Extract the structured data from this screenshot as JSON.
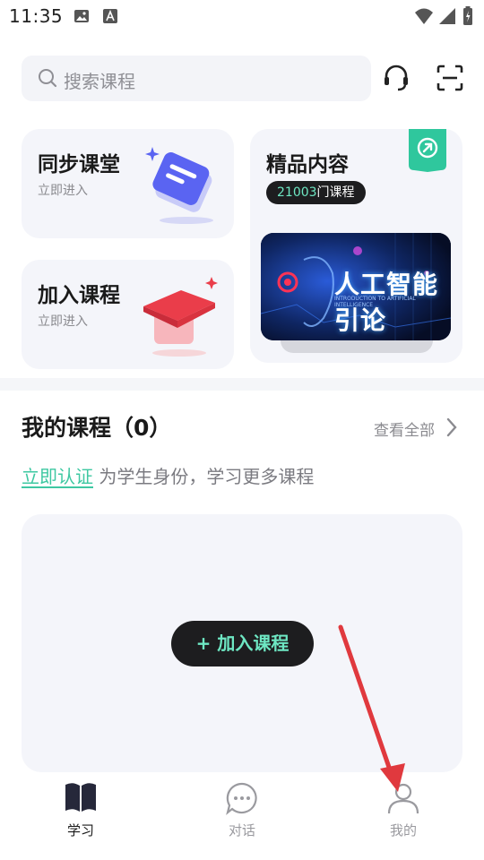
{
  "status_bar": {
    "time": "11:35",
    "icons": [
      "image-icon",
      "font-a-icon",
      "wifi-icon",
      "signal-icon",
      "battery-icon"
    ]
  },
  "search": {
    "placeholder": "搜索课程"
  },
  "header_icons": [
    "headset-icon",
    "scan-icon"
  ],
  "cards": {
    "sync_class": {
      "title": "同步课堂",
      "subtitle": "立即进入"
    },
    "join_course": {
      "title": "加入课程",
      "subtitle": "立即进入"
    },
    "premium": {
      "title": "精品内容",
      "count": "21003",
      "count_suffix": "门课程",
      "banner_text": "人工智能引论",
      "banner_small": "INTRODUCTION TO ARTIFICIAL INTELLIGENCE"
    }
  },
  "my_courses": {
    "title": "我的课程（0）",
    "view_all": "查看全部",
    "verify_link": "立即认证",
    "verify_text": " 为学生身份，学习更多课程",
    "join_button": "+ 加入课程"
  },
  "tabbar": {
    "tabs": [
      {
        "label": "学习",
        "active": true
      },
      {
        "label": "对话",
        "active": false
      },
      {
        "label": "我的",
        "active": false
      }
    ]
  },
  "colors": {
    "accent": "#3ec8a2",
    "accent_light": "#6ee7c3",
    "dark": "#1d1d1f",
    "card_bg": "#f4f5fa",
    "annotation_arrow": "#e0393e"
  }
}
